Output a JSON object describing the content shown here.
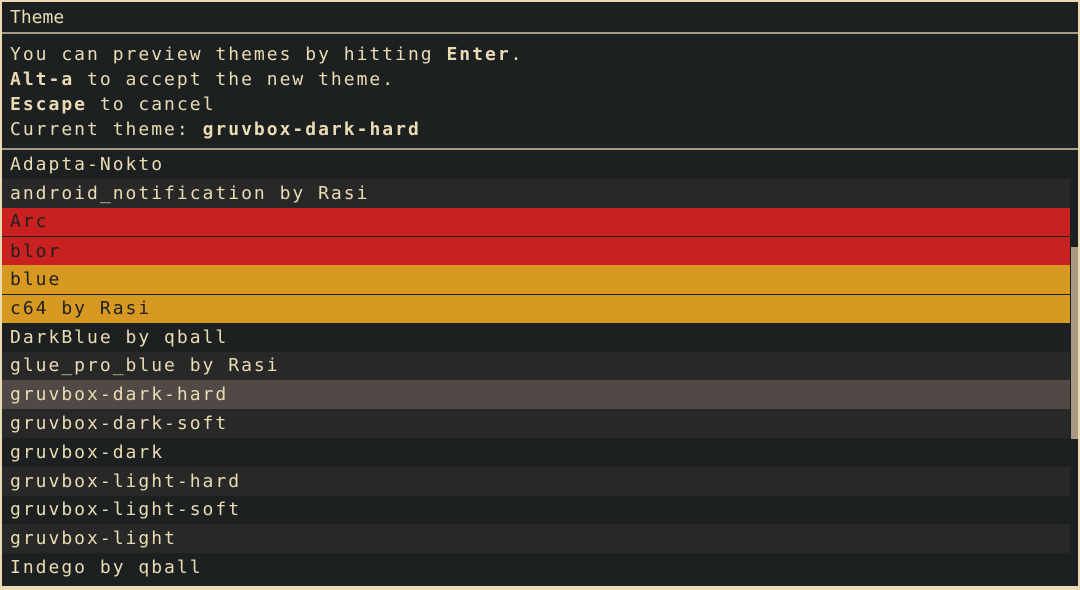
{
  "header": {
    "title": "Theme"
  },
  "help": {
    "line1_text": "You can preview themes by hitting ",
    "line1_key": "Enter",
    "line1_suffix": ".",
    "line2_key": "Alt-a",
    "line2_text": " to accept the new theme.",
    "line3_key": "Escape",
    "line3_text": " to cancel",
    "line4_label": "Current theme: ",
    "line4_value": "gruvbox-dark-hard"
  },
  "themes": [
    {
      "name": "Adapta-Nokto",
      "style": ""
    },
    {
      "name": "android_notification by Rasi",
      "style": "alt"
    },
    {
      "name": "Arc",
      "style": "red"
    },
    {
      "name": "blor",
      "style": "red red-border"
    },
    {
      "name": "blue",
      "style": "orange"
    },
    {
      "name": "c64 by Rasi",
      "style": "orange orange-border"
    },
    {
      "name": "DarkBlue by qball",
      "style": ""
    },
    {
      "name": "glue_pro_blue by Rasi",
      "style": "alt"
    },
    {
      "name": "gruvbox-dark-hard",
      "style": "selected"
    },
    {
      "name": "gruvbox-dark-soft",
      "style": "alt"
    },
    {
      "name": "gruvbox-dark",
      "style": ""
    },
    {
      "name": "gruvbox-light-hard",
      "style": "alt"
    },
    {
      "name": "gruvbox-light-soft",
      "style": ""
    },
    {
      "name": "gruvbox-light",
      "style": "alt"
    },
    {
      "name": "Indego by qball",
      "style": ""
    }
  ],
  "colors": {
    "bg": "#1d2021",
    "fg": "#ebdbb2",
    "border": "#a89984",
    "alt_bg": "#282828",
    "selected_bg": "#504945",
    "red": "#c92020",
    "orange": "#d79921"
  }
}
